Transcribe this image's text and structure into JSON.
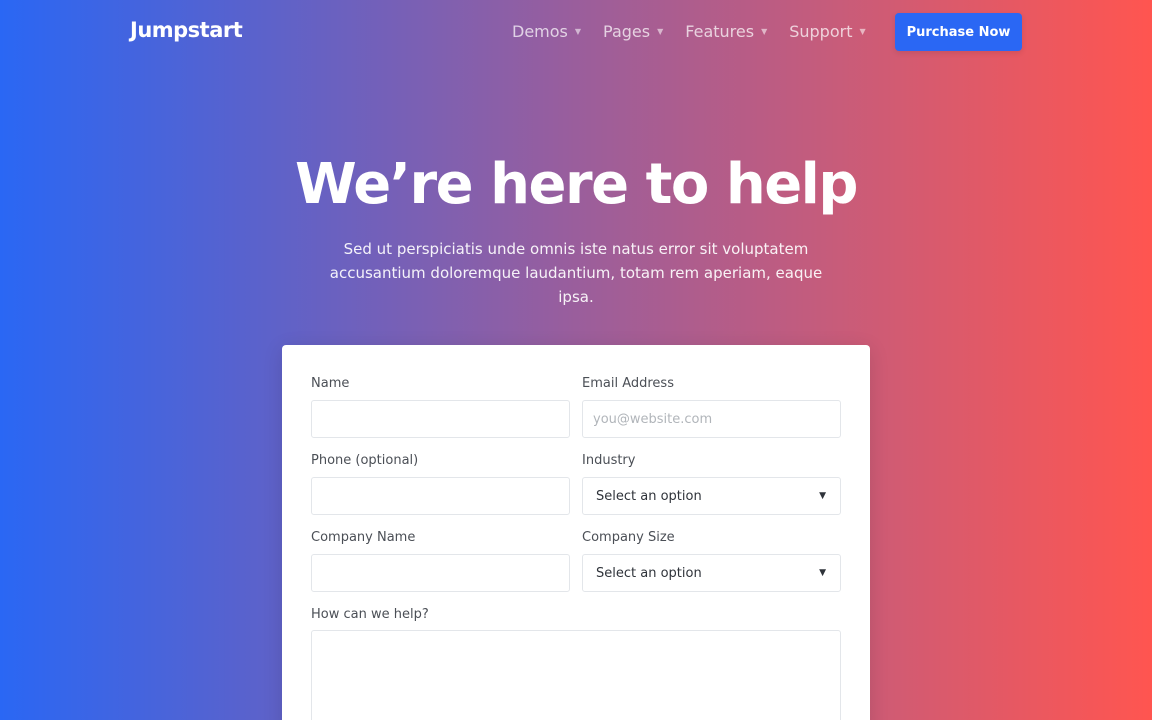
{
  "brand": {
    "name": "Jumpstart"
  },
  "nav": {
    "items": [
      {
        "label": "Demos"
      },
      {
        "label": "Pages"
      },
      {
        "label": "Features"
      },
      {
        "label": "Support"
      }
    ],
    "cta_label": "Purchase Now"
  },
  "hero": {
    "title": "We’re here to help",
    "subtitle": "Sed ut perspiciatis unde omnis iste natus error sit voluptatem accusantium doloremque laudantium, totam rem aperiam, eaque ipsa."
  },
  "form": {
    "name": {
      "label": "Name",
      "value": "",
      "placeholder": ""
    },
    "email": {
      "label": "Email Address",
      "value": "",
      "placeholder": "you@website.com"
    },
    "phone": {
      "label": "Phone (optional)",
      "value": "",
      "placeholder": ""
    },
    "industry": {
      "label": "Industry",
      "selected": "Select an option"
    },
    "company_name": {
      "label": "Company Name",
      "value": "",
      "placeholder": ""
    },
    "company_size": {
      "label": "Company Size",
      "selected": "Select an option"
    },
    "message": {
      "label": "How can we help?",
      "value": "",
      "placeholder": ""
    }
  },
  "colors": {
    "gradient_start": "#2a67f4",
    "gradient_end": "#ff5550",
    "button": "#2a67f4"
  },
  "icons": {
    "nav_caret": "caret-down-icon",
    "select_caret": "triangle-down-icon"
  }
}
